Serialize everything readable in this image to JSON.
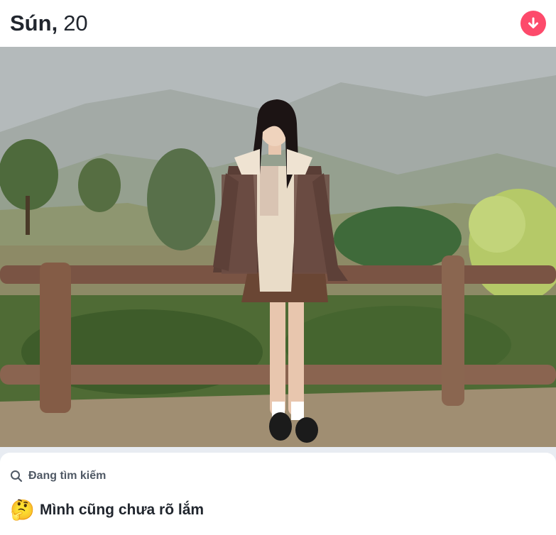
{
  "profile": {
    "name": "Sún",
    "age": "20"
  },
  "colors": {
    "accent": "#fd4a6b",
    "text_primary": "#21262e",
    "text_secondary": "#505965"
  },
  "icons": {
    "down_button": "arrow-down-icon",
    "search": "search-icon",
    "emoji": "thinking-face-emoji"
  },
  "looking_for": {
    "label": "Đang tìm kiếm",
    "value": "Mình cũng chưa rõ lắm",
    "emoji": "🤔"
  }
}
